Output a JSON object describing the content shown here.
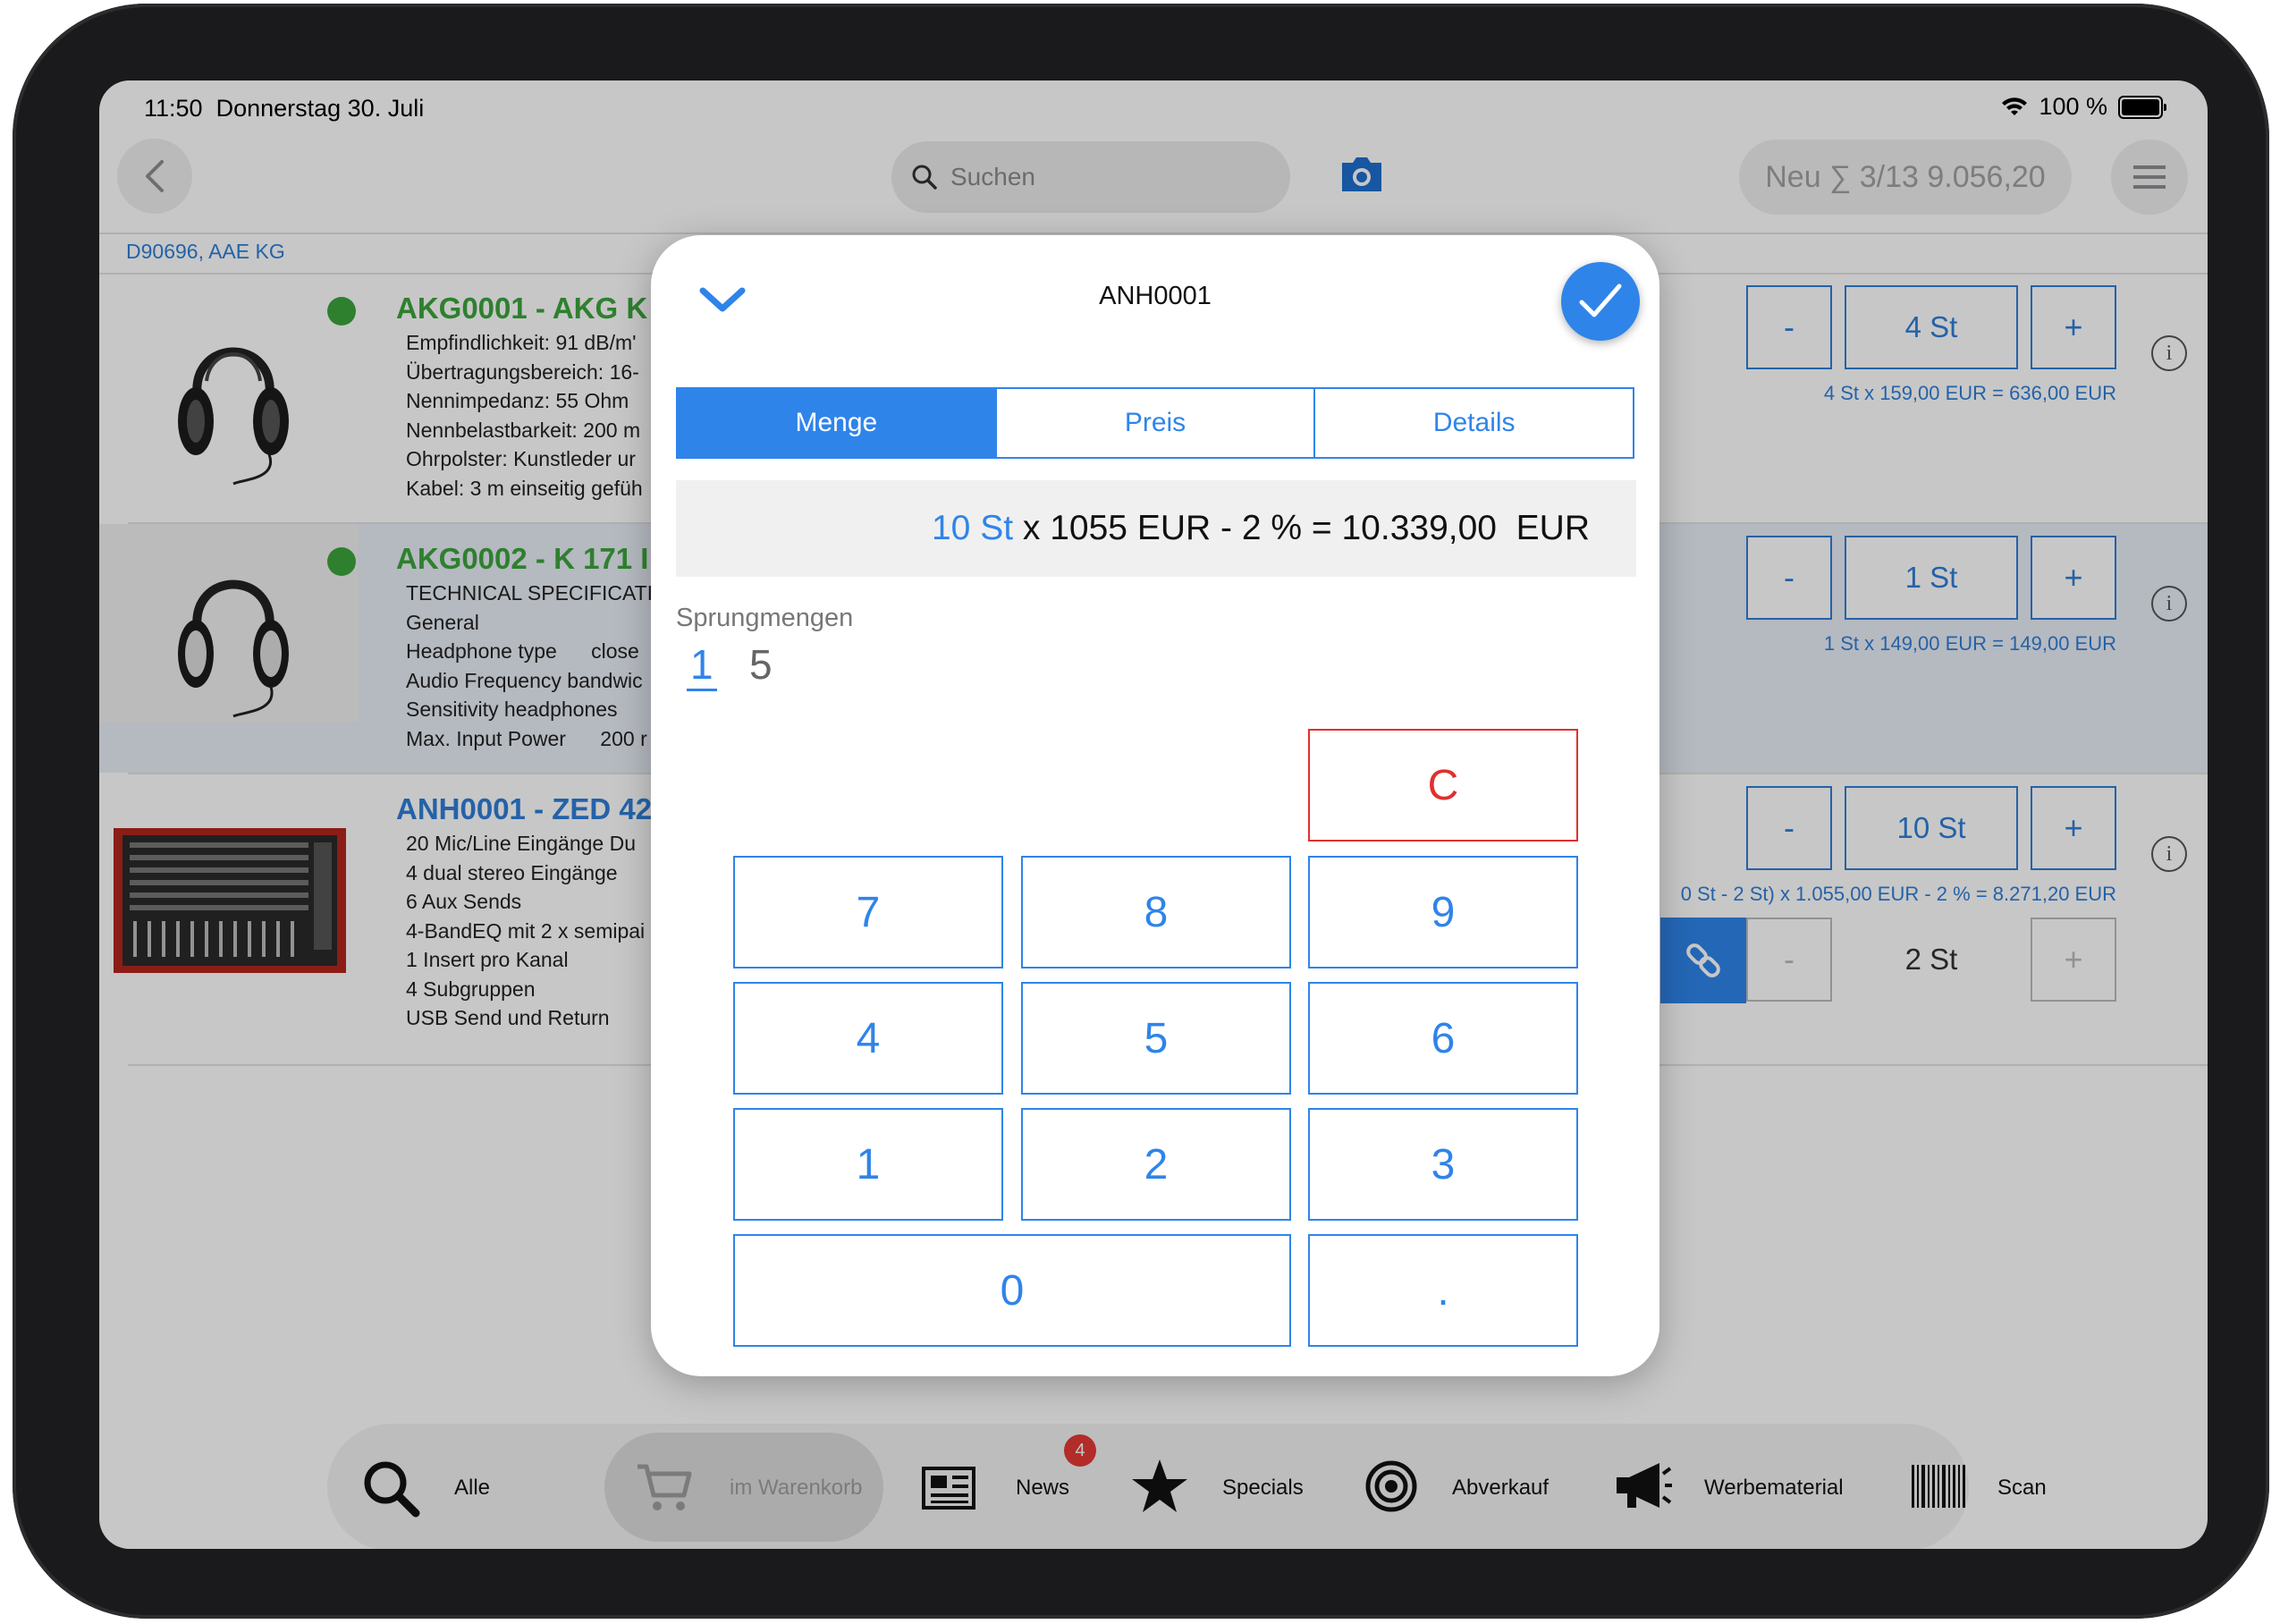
{
  "status": {
    "time": "11:50",
    "date": "Donnerstag 30. Juli",
    "battery": "100 %"
  },
  "nav": {
    "search_placeholder": "Suchen",
    "order_summary": "Neu ∑ 3/13 9.056,20"
  },
  "customer": "D90696, AAE KG",
  "products": [
    {
      "code_title": "AKG0001 - AKG K",
      "title_color": "#3ca53c",
      "description": "Empfindlichkeit: 91 dB/m'\nÜbertragungsbereich: 16-\nNennimpedanz: 55 Ohm\nNennbelastbarkeit: 200 m\nOhrpolster: Kunstleder ur\nKabel: 3 m einseitig gefüh",
      "qty": "4 St",
      "calc": "4 St x 159,00 EUR = 636,00 EUR",
      "in_stock": true
    },
    {
      "code_title": "AKG0002 - K 171 I",
      "title_color": "#3ca53c",
      "description": "TECHNICAL SPECIFICATI\nGeneral\nHeadphone type      close\nAudio Frequency bandwic\nSensitivity headphones\nMax. Input Power      200 r",
      "qty": "1 St",
      "calc": "1 St x 149,00 EUR = 149,00 EUR",
      "in_stock": true
    },
    {
      "code_title": "ANH0001 - ZED 42",
      "title_color": "#2f7ed8",
      "description": "20 Mic/Line Eingänge Du\n4 dual stereo Eingänge\n6 Aux Sends\n4-BandEQ mit 2 x semipai\n1 Insert pro Kanal\n4 Subgruppen\nUSB Send und Return",
      "qty": "10 St",
      "calc": "0 St - 2 St) x 1.055,00 EUR - 2 % = 8.271,20 EUR",
      "linked_qty": "2 St"
    }
  ],
  "qty_controls": {
    "minus": "-",
    "plus": "+"
  },
  "tabbar": {
    "items": [
      {
        "label": "Alle",
        "icon": "search-icon"
      },
      {
        "label": "im Warenkorb",
        "icon": "cart-icon"
      },
      {
        "label": "News",
        "icon": "newspaper-icon",
        "badge": "4"
      },
      {
        "label": "Specials",
        "icon": "star-icon"
      },
      {
        "label": "Abverkauf",
        "icon": "target-icon"
      },
      {
        "label": "Werbematerial",
        "icon": "megaphone-icon"
      },
      {
        "label": "Scan",
        "icon": "barcode-icon"
      }
    ]
  },
  "modal": {
    "title": "ANH0001",
    "tabs": [
      "Menge",
      "Preis",
      "Details"
    ],
    "active_tab": "Menge",
    "formula_qty": "10 St",
    "formula_rest": " x 1055 EUR - 2 % = 10.339,00  EUR",
    "sprung_label": "Sprungmengen",
    "sprung_values": [
      "1",
      "5"
    ],
    "keys": {
      "clear": "C",
      "k7": "7",
      "k8": "8",
      "k9": "9",
      "k4": "4",
      "k5": "5",
      "k6": "6",
      "k1": "1",
      "k2": "2",
      "k3": "3",
      "k0": "0",
      "dot": "."
    }
  },
  "colors": {
    "accent": "#2f84ea",
    "in_stock": "#3ca53c",
    "clear": "#e0302f",
    "badge": "#e53935"
  }
}
